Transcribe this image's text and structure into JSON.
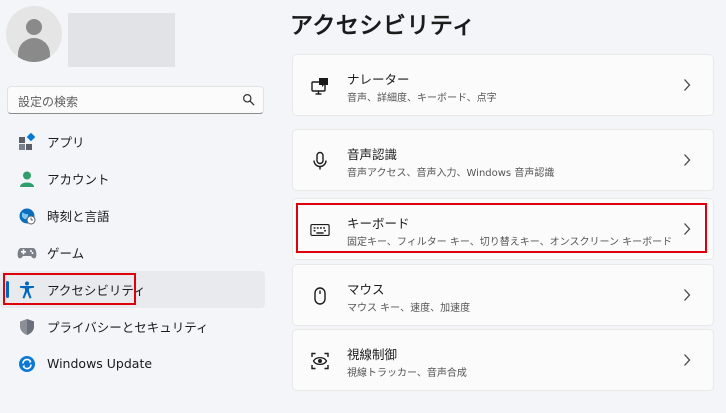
{
  "window": {
    "title": "アクセシビリティ"
  },
  "search": {
    "placeholder": "設定の検索"
  },
  "sidebar": {
    "items": [
      {
        "label": "アプリ",
        "icon": "apps-icon"
      },
      {
        "label": "アカウント",
        "icon": "account-icon"
      },
      {
        "label": "時刻と言語",
        "icon": "time-language-icon"
      },
      {
        "label": "ゲーム",
        "icon": "gaming-icon"
      },
      {
        "label": "アクセシビリティ",
        "icon": "accessibility-icon",
        "selected": true
      },
      {
        "label": "プライバシーとセキュリティ",
        "icon": "shield-icon"
      },
      {
        "label": "Windows Update",
        "icon": "windows-update-icon"
      }
    ]
  },
  "main": {
    "cards": [
      {
        "title": "ナレーター",
        "subtitle": "音声、詳細度、キーボード、点字",
        "icon": "narrator-icon"
      },
      {
        "title": "音声認識",
        "subtitle": "音声アクセス、音声入力、Windows 音声認識",
        "icon": "microphone-icon"
      },
      {
        "title": "キーボード",
        "subtitle": "固定キー、フィルター キー、切り替えキー、オンスクリーン キーボード",
        "icon": "keyboard-icon"
      },
      {
        "title": "マウス",
        "subtitle": "マウス キー、速度、加速度",
        "icon": "mouse-icon"
      },
      {
        "title": "視線制御",
        "subtitle": "視線トラッカー、音声合成",
        "icon": "eye-control-icon"
      }
    ]
  },
  "colors": {
    "accent": "#0067c0",
    "highlight": "#e0000b",
    "background": "#f3f5f9"
  }
}
